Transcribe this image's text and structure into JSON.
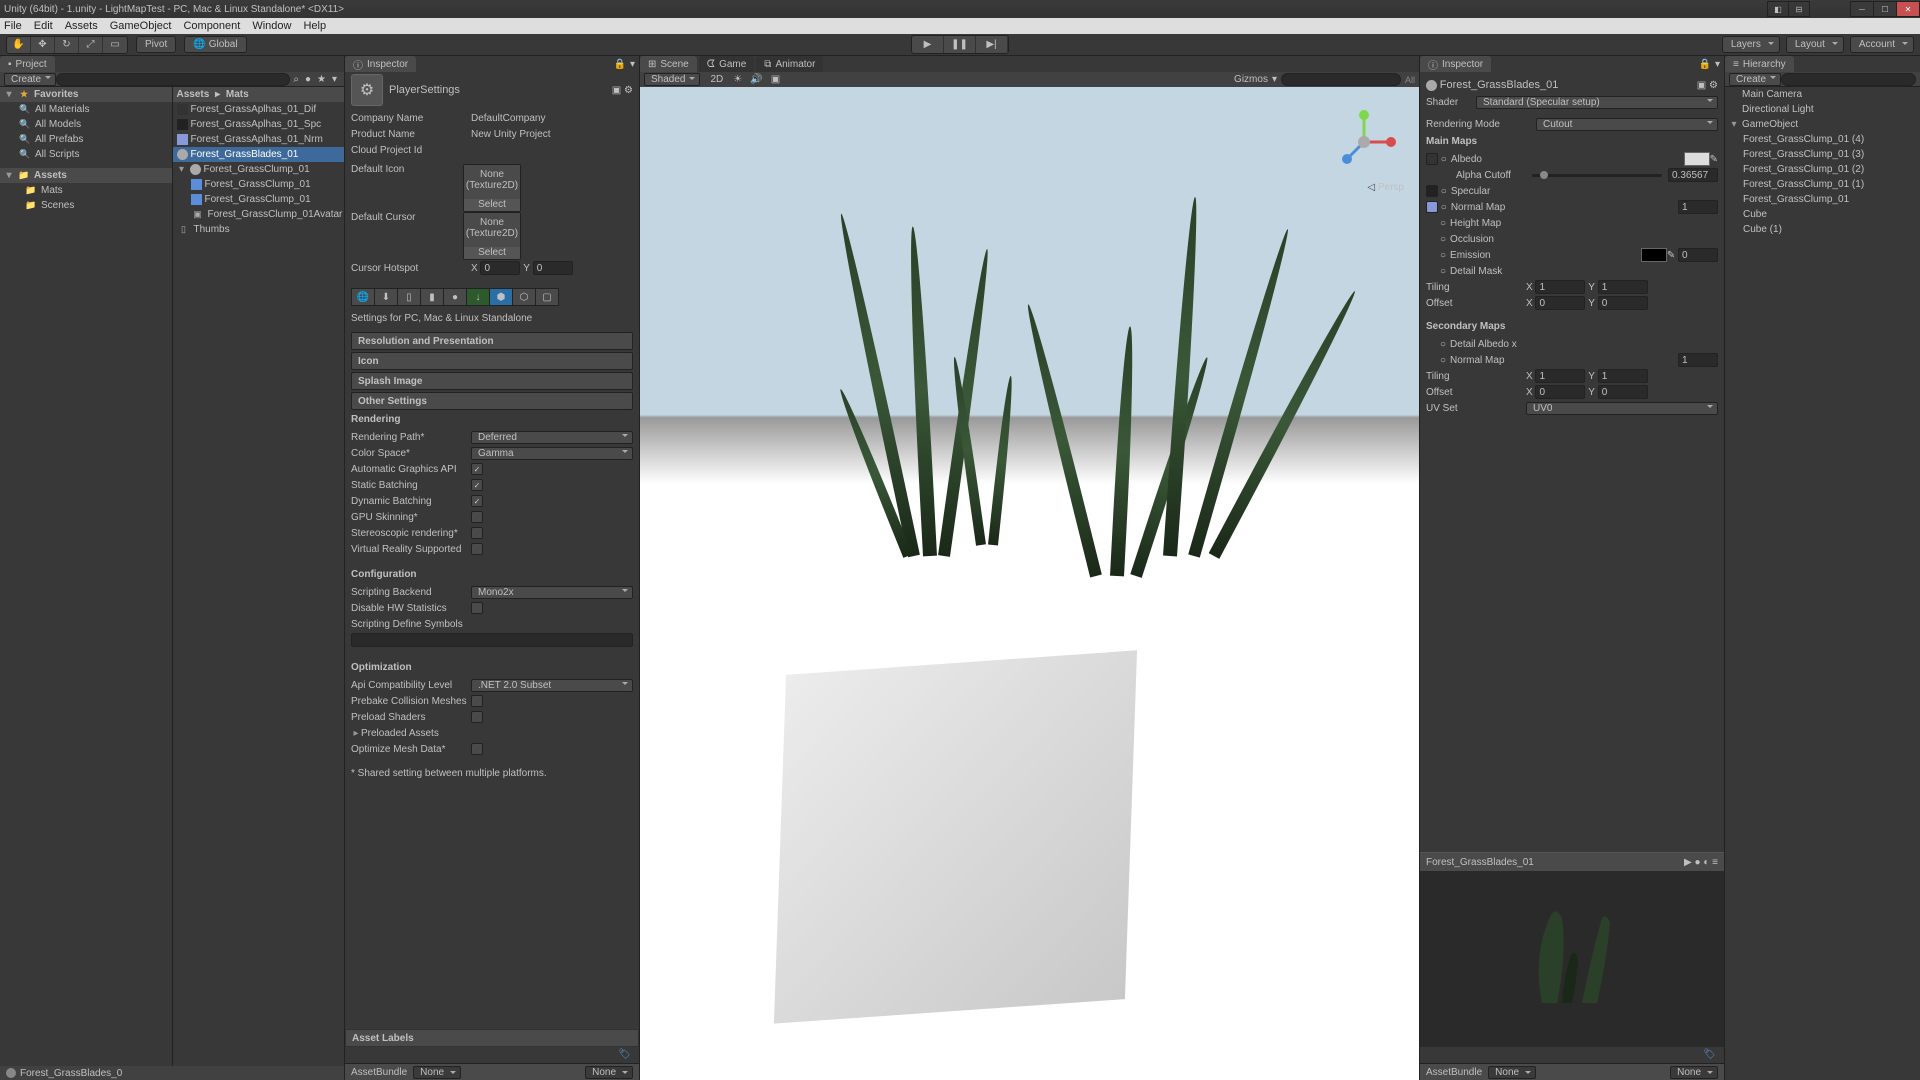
{
  "title": "Unity (64bit) - 1.unity - LightMapTest - PC, Mac & Linux Standalone* <DX11>",
  "menus": [
    "File",
    "Edit",
    "Assets",
    "GameObject",
    "Component",
    "Window",
    "Help"
  ],
  "toolbar": {
    "pivot": "Pivot",
    "global": "Global",
    "layers": "Layers",
    "layout": "Layout",
    "account": "Account"
  },
  "project": {
    "tab": "Project",
    "create": "Create",
    "fav": "Favorites",
    "fav_items": [
      "All Materials",
      "All Models",
      "All Prefabs",
      "All Scripts"
    ],
    "assets": "Assets",
    "mats": "Mats",
    "scenes": "Scenes",
    "crumb1": "Assets",
    "crumb2": "Mats",
    "files": [
      "Forest_GrassAplhas_01_Dif",
      "Forest_GrassAplhas_01_Spc",
      "Forest_GrassAplhas_01_Nrm",
      "Forest_GrassBlades_01",
      "Forest_GrassClump_01",
      "Forest_GrassClump_01",
      "Forest_GrassClump_01",
      "Forest_GrassClump_01Avatar",
      "Thumbs"
    ],
    "sel_idx": 3,
    "status": "Forest_GrassBlades_0"
  },
  "inspector1": {
    "tab": "Inspector",
    "title": "PlayerSettings",
    "company_l": "Company Name",
    "company_v": "DefaultCompany",
    "product_l": "Product Name",
    "product_v": "New Unity Project",
    "cloud_l": "Cloud Project Id",
    "icon_l": "Default Icon",
    "icon_none": "None",
    "icon_tex": "(Texture2D)",
    "select": "Select",
    "cursor_l": "Default Cursor",
    "hotspot_l": "Cursor Hotspot",
    "x": "X",
    "x_v": "0",
    "y": "Y",
    "y_v": "0",
    "settings_for": "Settings for PC, Mac & Linux Standalone",
    "s1": "Resolution and Presentation",
    "s2": "Icon",
    "s3": "Splash Image",
    "s4": "Other Settings",
    "rendering": "Rendering",
    "rp_l": "Rendering Path*",
    "rp_v": "Deferred",
    "cs_l": "Color Space*",
    "cs_v": "Gamma",
    "agi": "Automatic Graphics API",
    "sb": "Static Batching",
    "db": "Dynamic Batching",
    "gpu": "GPU Skinning*",
    "stereo": "Stereoscopic rendering*",
    "vr": "Virtual Reality Supported",
    "config": "Configuration",
    "sbe_l": "Scripting Backend",
    "sbe_v": "Mono2x",
    "dhw": "Disable HW Statistics",
    "sds": "Scripting Define Symbols",
    "opt": "Optimization",
    "api_l": "Api Compatibility Level",
    "api_v": ".NET 2.0 Subset",
    "pcm": "Prebake Collision Meshes",
    "ps": "Preload Shaders",
    "pa": "Preloaded Assets",
    "omd": "Optimize Mesh Data*",
    "shared": "* Shared setting between multiple platforms.",
    "asset_labels": "Asset Labels",
    "bundle_l": "AssetBundle",
    "none": "None"
  },
  "scene": {
    "t1": "Scene",
    "t2": "Game",
    "t3": "Animator",
    "shaded": "Shaded",
    "d2": "2D",
    "gizmos": "Gizmos",
    "all": "All",
    "persp": "Persp"
  },
  "inspector2": {
    "tab": "Inspector",
    "name": "Forest_GrassBlades_01",
    "shader_l": "Shader",
    "shader_v": "Standard (Specular setup)",
    "rmode_l": "Rendering Mode",
    "rmode_v": "Cutout",
    "main": "Main Maps",
    "albedo": "Albedo",
    "cutoff": "Alpha Cutoff",
    "cutoff_v": "0.36567",
    "spec": "Specular",
    "nmap": "Normal Map",
    "nmap_v": "1",
    "hmap": "Height Map",
    "occ": "Occlusion",
    "emis": "Emission",
    "emis_v": "0",
    "mask": "Detail Mask",
    "tiling": "Tiling",
    "offset": "Offset",
    "x": "X",
    "y": "Y",
    "one": "1",
    "zero": "0",
    "sec": "Secondary Maps",
    "dalb": "Detail Albedo x",
    "uv_l": "UV Set",
    "uv_v": "UV0",
    "bundle_l": "AssetBundle",
    "none": "None"
  },
  "hierarchy": {
    "tab": "Hierarchy",
    "create": "Create",
    "items": [
      "Main Camera",
      "Directional Light",
      "GameObject",
      "Forest_GrassClump_01 (4)",
      "Forest_GrassClump_01 (3)",
      "Forest_GrassClump_01 (2)",
      "Forest_GrassClump_01 (1)",
      "Forest_GrassClump_01",
      "Cube",
      "Cube (1)"
    ]
  }
}
